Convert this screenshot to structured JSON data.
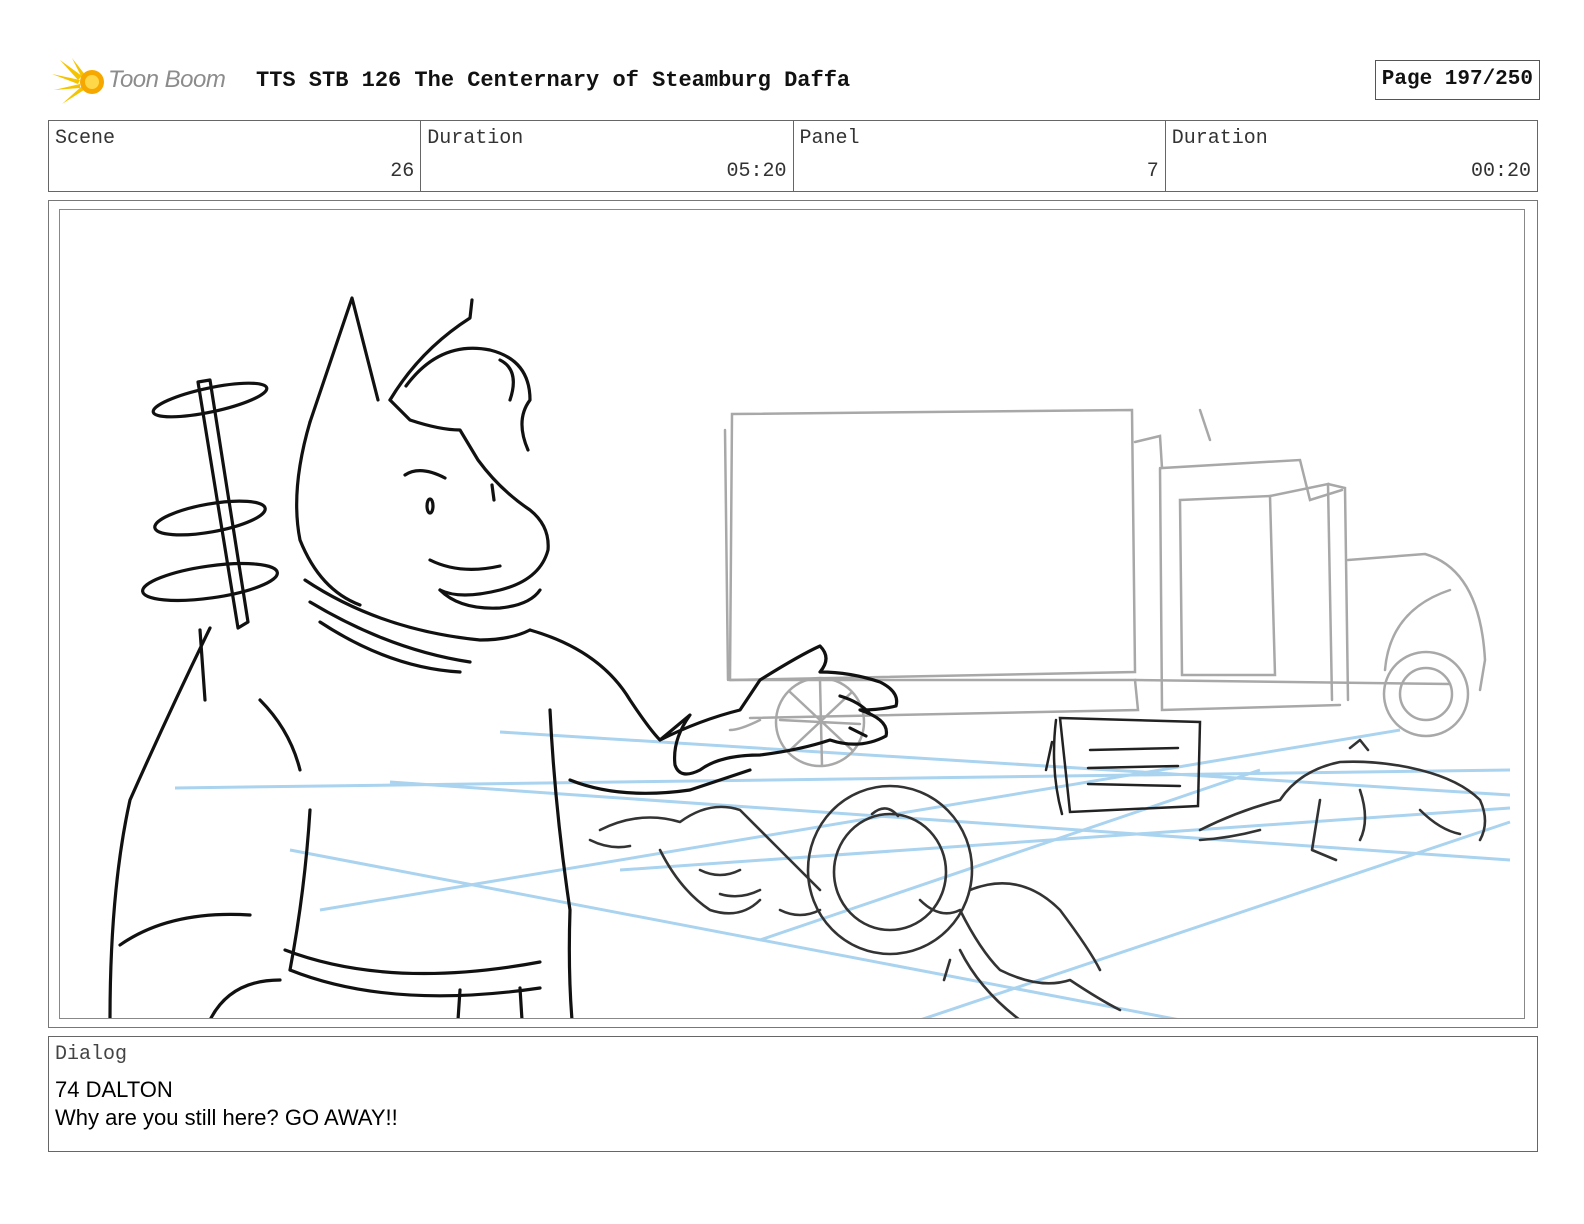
{
  "header": {
    "logo_text": "Toon Boom",
    "title": "TTS STB 126 The Centernary of Steamburg Daffa",
    "page": "Page 197/250"
  },
  "info": {
    "scene_label": "Scene",
    "scene_value": "26",
    "scene_duration_label": "Duration",
    "scene_duration_value": "05:20",
    "panel_label": "Panel",
    "panel_value": "7",
    "panel_duration_label": "Duration",
    "panel_duration_value": "00:20"
  },
  "dialog": {
    "label": "Dialog",
    "speaker": "74 DALTON",
    "line": "Why are you still here? GO AWAY!!"
  },
  "colors": {
    "sketch": "#111111",
    "background_sketch": "#a8a8a8",
    "perspective_lines": "#a9d3ef",
    "logo_accent": "#f5c400"
  }
}
